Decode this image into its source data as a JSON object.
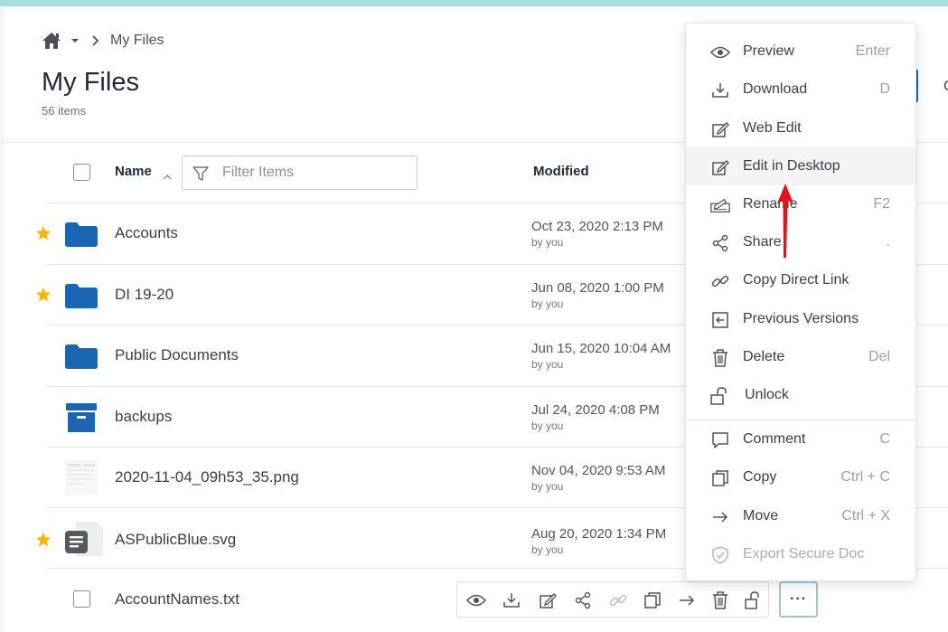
{
  "breadcrumb": {
    "home_icon": "home-icon",
    "current": "My Files"
  },
  "header": {
    "title": "My Files",
    "count": "56 items",
    "button_partial": "C"
  },
  "table": {
    "col_name": "Name",
    "col_modified": "Modified",
    "filter_placeholder": "Filter Items"
  },
  "files": [
    {
      "name": "Accounts",
      "date": "Oct 23, 2020 2:13 PM",
      "by": "by you",
      "icon": "folder-icon",
      "starred": true
    },
    {
      "name": "DI 19-20",
      "date": "Jun 08, 2020 1:00 PM",
      "by": "by you",
      "icon": "folder-icon",
      "starred": true
    },
    {
      "name": "Public Documents",
      "date": "Jun 15, 2020 10:04 AM",
      "by": "by you",
      "icon": "folder-icon",
      "starred": false
    },
    {
      "name": "backups",
      "date": "Jul 24, 2020 4:08 PM",
      "by": "by you",
      "icon": "archive-box-icon",
      "starred": false
    },
    {
      "name": "2020-11-04_09h53_35.png",
      "date": "Nov 04, 2020 9:53 AM",
      "by": "by you",
      "icon": "image-thumbnail-icon",
      "starred": false
    },
    {
      "name": "ASPublicBlue.svg",
      "date": "Aug 20, 2020 1:34 PM",
      "by": "by you",
      "icon": "document-icon",
      "starred": true
    },
    {
      "name": "AccountNames.txt",
      "date": "",
      "by": "",
      "icon": "",
      "starred": false
    }
  ],
  "context_menu": {
    "items": [
      {
        "label": "Preview",
        "shortcut": "Enter",
        "icon": "eye-icon"
      },
      {
        "label": "Download",
        "shortcut": "D",
        "icon": "download-icon"
      },
      {
        "label": "Web Edit",
        "shortcut": "",
        "icon": "edit-icon"
      },
      {
        "label": "Edit in Desktop",
        "shortcut": "",
        "icon": "edit-icon"
      },
      {
        "label": "Rename",
        "shortcut": "F2",
        "icon": "rename-icon"
      },
      {
        "label": "Share",
        "shortcut": ".",
        "icon": "share-icon"
      },
      {
        "label": "Copy Direct Link",
        "shortcut": "",
        "icon": "link-icon"
      },
      {
        "label": "Previous Versions",
        "shortcut": "",
        "icon": "history-icon"
      },
      {
        "label": "Delete",
        "shortcut": "Del",
        "icon": "trash-icon"
      },
      {
        "label": "Unlock",
        "shortcut": "",
        "icon": "unlock-icon"
      },
      {
        "label": "Comment",
        "shortcut": "C",
        "icon": "comment-icon"
      },
      {
        "label": "Copy",
        "shortcut": "Ctrl + C",
        "icon": "copy-icon"
      },
      {
        "label": "Move",
        "shortcut": "Ctrl + X",
        "icon": "move-arrow-icon"
      },
      {
        "label": "Export Secure Doc",
        "shortcut": "",
        "icon": "shield-check-icon"
      }
    ],
    "highlighted": "Edit in Desktop",
    "disabled": "Export Secure Doc"
  },
  "row_actions": {
    "icons": [
      "eye-icon",
      "download-icon",
      "edit-icon",
      "share-icon",
      "link-icon",
      "copy-icon",
      "move-arrow-icon",
      "trash-icon",
      "unlock-icon"
    ],
    "more_label": "···"
  },
  "colors": {
    "accent_blue": "#1a66b3",
    "star": "#f5b800",
    "annotation_arrow": "#e3121b"
  }
}
